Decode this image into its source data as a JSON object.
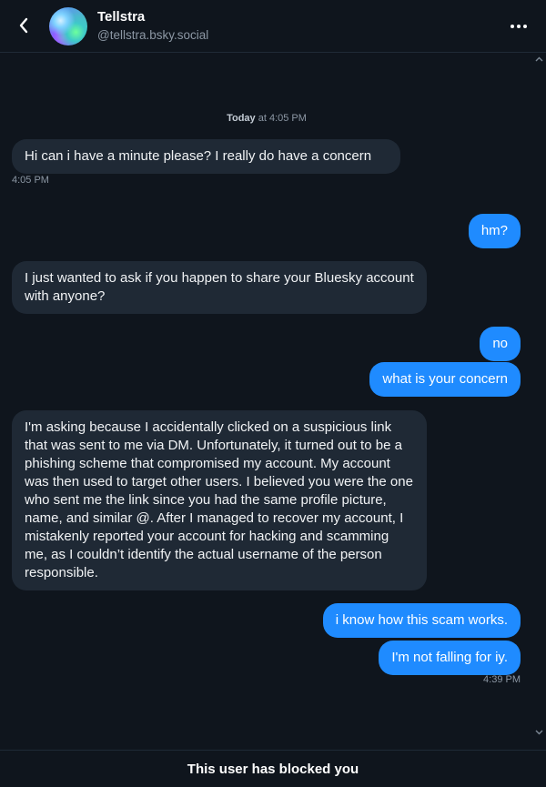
{
  "header": {
    "name": "Tellstra",
    "handle": "@tellstra.bsky.social"
  },
  "date_separator": {
    "day": "Today",
    "time": "at 4:05 PM"
  },
  "messages": [
    {
      "direction": "incoming",
      "text": "Hi can i have a minute please? I really do have a concern",
      "timestamp": "4:05 PM"
    },
    {
      "direction": "outgoing",
      "text": "hm?"
    },
    {
      "direction": "incoming",
      "text": "I just wanted to ask if you happen to share your Bluesky account with anyone?"
    },
    {
      "direction": "outgoing",
      "text": "no"
    },
    {
      "direction": "outgoing",
      "text": "what is your concern"
    },
    {
      "direction": "incoming",
      "text": "I'm asking because I accidentally clicked on a suspicious link that was sent to me via DM. Unfortunately, it turned out to be a phishing scheme that compromised my account. My account was then used to target other users. I believed you were the one who sent me the link since you had the same profile picture, name, and similar @. After I managed to recover my account, I mistakenly reported your account for hacking and scamming me, as I couldn’t identify the actual username of the person responsible."
    },
    {
      "direction": "outgoing",
      "text": "i know how this scam works."
    },
    {
      "direction": "outgoing",
      "text": "I'm not falling for iy.",
      "timestamp": "4:39 PM"
    }
  ],
  "footer": {
    "notice": "This user has blocked you"
  },
  "icons": {
    "back": "chevron-left-icon",
    "menu": "more-horizontal-icon"
  },
  "colors": {
    "background": "#0f151d",
    "incoming_bubble": "#1f2935",
    "outgoing_bubble": "#1f8bff"
  }
}
